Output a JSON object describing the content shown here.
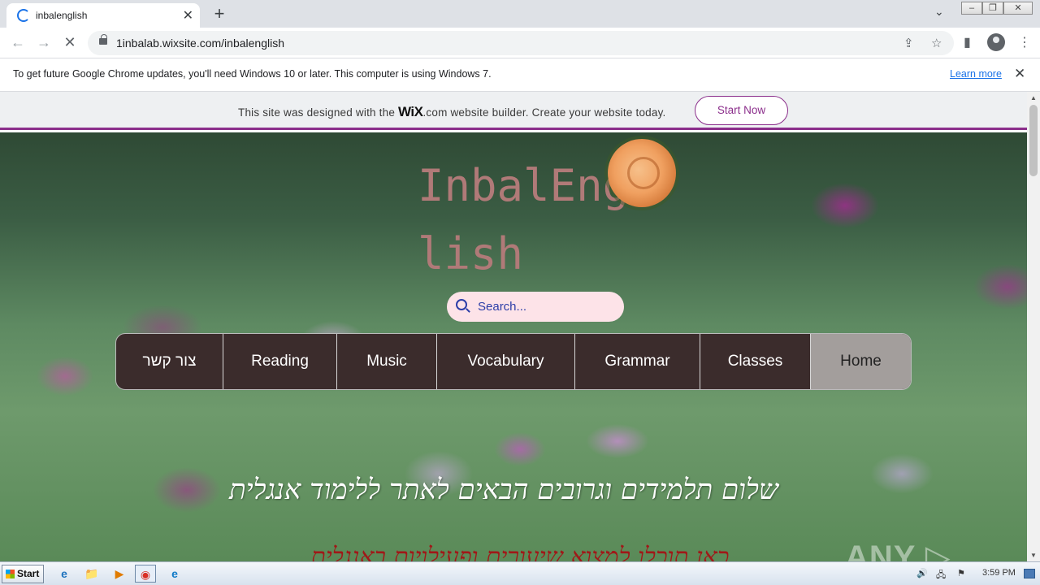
{
  "browser": {
    "tab_title": "inbalenglish",
    "new_tab_symbol": "+",
    "close_symbol": "✕",
    "url": "1inbalab.wixsite.com/inbalenglish",
    "tab_search_symbol": "⌄",
    "window_controls": [
      "–",
      "❐",
      "✕"
    ],
    "back_symbol": "←",
    "forward_symbol": "→",
    "stop_symbol": "✕",
    "share_symbol": "⇪",
    "bookmark_symbol": "☆",
    "sidepanel_symbol": "▮",
    "menu_symbol": "⋮"
  },
  "infobar": {
    "message": "To get future Google Chrome updates, you'll need Windows 10 or later. This computer is using Windows 7.",
    "learn_more": "Learn more",
    "close_symbol": "✕"
  },
  "wix_banner": {
    "prefix": "This site was designed with the ",
    "brand": "WiX",
    "suffix": ".com website builder. Create your website today.",
    "button": "Start Now"
  },
  "site": {
    "title": "InbalEnglish",
    "search_placeholder": "Search...",
    "menu": [
      "צור קשר",
      "Reading",
      "Music",
      "Vocabulary",
      "Grammar",
      "Classes",
      "Home"
    ],
    "greeting": "שלום תלמידים וגרובים הבאים לאתר ללימוד אנגלית",
    "subline": "כאן תוכלו למצוא שיעורים ופעילויות באנגלית"
  },
  "watermark": "ANY ▷ RUN",
  "taskbar": {
    "start_label": "Start",
    "apps": [
      "e",
      "📁",
      "▶",
      "◉",
      "e"
    ],
    "tray_icons": [
      "🔊",
      "🖧",
      "⚑"
    ],
    "clock": "3:59 PM"
  },
  "colors": {
    "wix_accent": "#8b2e8b",
    "menu_bg": "#3b2c2c",
    "menu_active": "#a39e9c",
    "title_color": "#b07a78",
    "search_bg": "#fde3e8"
  }
}
